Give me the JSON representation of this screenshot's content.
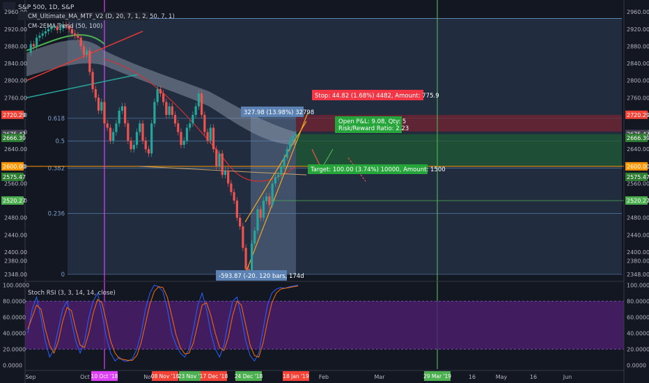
{
  "header": {
    "symbol": "S&P 500, 1D, S&P",
    "indicator_1": "CM_Ultimate_MA_MTF_V2 (D, 20, 7, 1, 2, 50, 7, 1)",
    "indicator_2": "CM-2EMA-Trend (50, 100)"
  },
  "colors": {
    "background": "#131722",
    "up": "#26a69a",
    "down": "#ef5350",
    "stop_zone": "#7a2230",
    "target_zone": "#1f5a34",
    "fib_fill": "#2e3f57",
    "magenta_line": "#e040fb",
    "green_line": "#4caf50",
    "rsi_band": "#4a1f6b"
  },
  "annotations": {
    "stop": "Stop: 44.82 (1.68%) 4482, Amount: 775.9",
    "target": "Target: 100.00 (3.74%) 10000, Amount: 1500",
    "pnl_1": "Open P&L: 9.08, Qty: 5",
    "pnl_2": "Risk/Reward Ratio: 2.23",
    "range_top": "327.98 (13.98%) 32798",
    "range_bottom": "-593.87 (-20. 120 bars, 174d"
  },
  "rsi_title": "Stoch RSI (3, 3, 14, 14, close)",
  "chart_data": [
    {
      "type": "candlestick",
      "title": "S&P 500, 1D, S&P",
      "ylim": [
        2335,
        2975
      ],
      "y_ticks": [
        "2960.00",
        "2920.00",
        "2880.00",
        "2840.00",
        "2800.00",
        "2760.00",
        "2720.00",
        "2680.00",
        "2640.00",
        "2600.00",
        "2560.00",
        "2520.00",
        "2480.00",
        "2440.00",
        "2400.00",
        "2380.00",
        "2348.00"
      ],
      "fib_levels": [
        {
          "label": "0.618",
          "value": 2712
        },
        {
          "label": "0.5",
          "value": 2659
        },
        {
          "label": "0.382",
          "value": 2596
        },
        {
          "label": "0.236",
          "value": 2490
        },
        {
          "label": "0",
          "value": 2348
        }
      ],
      "price_labels": [
        {
          "text": "2720.29",
          "value": 2720.29,
          "color": "#f44336"
        },
        {
          "text": "2675.47",
          "value": 2675.47,
          "color": "#434651"
        },
        {
          "text": "2666.39",
          "value": 2666.39,
          "color": "#2e7d32"
        },
        {
          "text": "2600.00",
          "value": 2600,
          "color": "#ff9800"
        },
        {
          "text": "2575.47",
          "value": 2575.47,
          "color": "#2e7d32"
        },
        {
          "text": "2520.27",
          "value": 2520.27,
          "color": "#4caf50"
        }
      ],
      "series": [
        {
          "values": [
            2865,
            2885,
            2880,
            2900,
            2905,
            2910,
            2915,
            2920,
            2925,
            2925,
            2918,
            2922,
            2930,
            2928,
            2920,
            2910,
            2905,
            2900,
            2880,
            2860,
            2870,
            2820,
            2780,
            2760,
            2730,
            2750,
            2700,
            2690,
            2660,
            2680,
            2700,
            2730,
            2740,
            2700,
            2660,
            2640,
            2650,
            2680,
            2700,
            2660,
            2640,
            2630,
            2700,
            2750,
            2780,
            2770,
            2750,
            2720,
            2740,
            2720,
            2700,
            2680,
            2650,
            2660,
            2690,
            2700,
            2720,
            2740,
            2770,
            2720,
            2680,
            2660,
            2690,
            2640,
            2600,
            2630,
            2580,
            2590,
            2560,
            2540,
            2520,
            2480,
            2460,
            2410,
            2360,
            2350,
            2420,
            2450,
            2500,
            2480,
            2520,
            2530,
            2510,
            2560,
            2575,
            2580,
            2600,
            2620,
            2640,
            2660,
            2670,
            2675
          ]
        }
      ]
    },
    {
      "type": "line",
      "title": "Stoch RSI (3, 3, 14, 14, close)",
      "ylim": [
        -5,
        103
      ],
      "y_ticks": [
        "100.0000",
        "80.0000",
        "60.0000",
        "40.0000",
        "20.0000",
        "0.0000"
      ],
      "series": [
        {
          "name": "K",
          "values": [
            40,
            70,
            85,
            60,
            30,
            10,
            20,
            45,
            70,
            80,
            55,
            30,
            15,
            30,
            60,
            80,
            90,
            65,
            35,
            15,
            5,
            10,
            5,
            5,
            8,
            20,
            40,
            70,
            90,
            100,
            98,
            92,
            70,
            40,
            25,
            15,
            10,
            20,
            45,
            75,
            90,
            70,
            40,
            20,
            10,
            25,
            55,
            80,
            85,
            60,
            30,
            12,
            5,
            15,
            45,
            75,
            90,
            95,
            97,
            96,
            98,
            99,
            100
          ]
        },
        {
          "name": "D",
          "values": [
            45,
            60,
            75,
            70,
            45,
            25,
            15,
            30,
            55,
            72,
            68,
            45,
            25,
            22,
            40,
            65,
            82,
            78,
            55,
            30,
            15,
            8,
            7,
            6,
            6,
            12,
            28,
            52,
            76,
            92,
            98,
            97,
            85,
            62,
            38,
            22,
            14,
            15,
            28,
            52,
            75,
            78,
            62,
            40,
            22,
            18,
            35,
            62,
            80,
            75,
            50,
            25,
            12,
            10,
            28,
            55,
            78,
            90,
            95,
            96,
            97,
            98,
            99
          ]
        }
      ]
    }
  ],
  "x_axis": {
    "labels": [
      "Sep",
      "Oct",
      "Nov",
      "Dec",
      "Feb",
      "Mar",
      "16",
      "May",
      "16",
      "Jun"
    ],
    "highlighted": [
      "10 Oct '18",
      "08 Nov '18",
      "23 Nov '18",
      "17 Dec '18",
      "24 Dec '18",
      "18 Jan '19",
      "29 Mar '19"
    ]
  }
}
